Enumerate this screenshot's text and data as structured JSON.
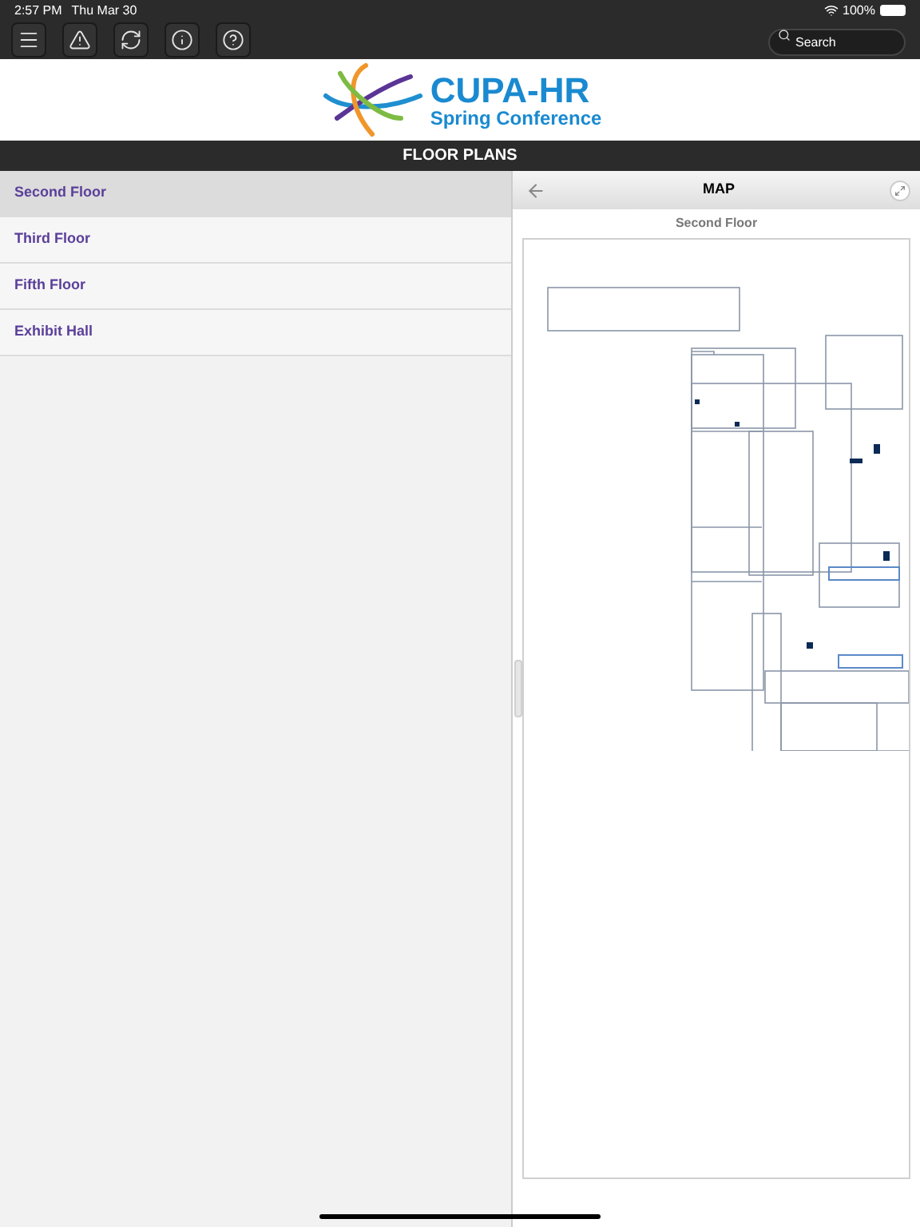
{
  "status_bar": {
    "time": "2:57 PM",
    "date": "Thu Mar 30",
    "battery": "100%"
  },
  "toolbar": {
    "search": {
      "placeholder": "Search"
    }
  },
  "logo": {
    "name": "CUPA-HR",
    "subtitle": "Spring Conference"
  },
  "section_title": "FLOOR PLANS",
  "floors": [
    {
      "label": "Second Floor",
      "selected": true
    },
    {
      "label": "Third Floor",
      "selected": false
    },
    {
      "label": "Fifth Floor",
      "selected": false
    },
    {
      "label": "Exhibit Hall",
      "selected": false
    }
  ],
  "map_panel": {
    "title": "MAP",
    "caption": "Second Floor"
  }
}
